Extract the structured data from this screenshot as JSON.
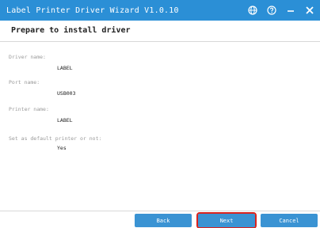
{
  "window": {
    "title": "Label Printer Driver Wizard  V1.0.10",
    "controls": [
      {
        "name": "globe-icon"
      },
      {
        "name": "help-icon"
      },
      {
        "name": "minimize-icon"
      },
      {
        "name": "close-icon"
      }
    ]
  },
  "header": {
    "title": "Prepare to install driver"
  },
  "fields": [
    {
      "label": "Driver name:",
      "value": "LABEL"
    },
    {
      "label": "Port name:",
      "value": "USB003"
    },
    {
      "label": "Printer name:",
      "value": "LABEL"
    },
    {
      "label": "Set as default printer or not:",
      "value": "Yes"
    }
  ],
  "footer": {
    "back_label": "Back",
    "next_label": "Next",
    "cancel_label": "Cancel"
  },
  "colors": {
    "titlebar": "#2b8fd6",
    "button": "#3a93d3",
    "focus_outline": "#d9231d"
  }
}
